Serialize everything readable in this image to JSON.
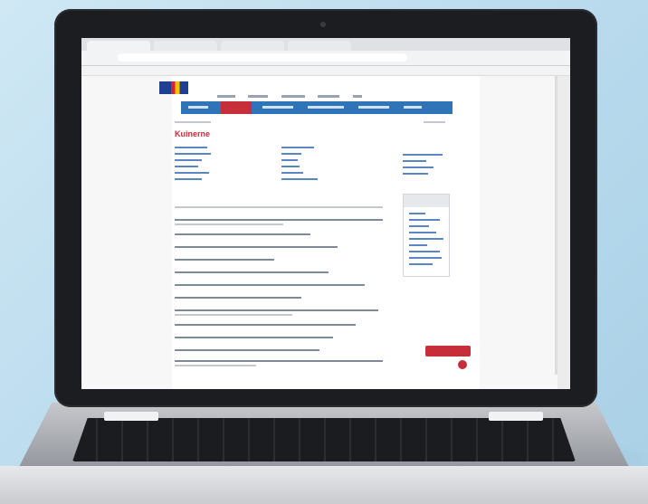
{
  "scene": {
    "background_color": "#bcdcee",
    "device": "laptop",
    "screen_content": "browser-webpage"
  },
  "webpage": {
    "heading": "Kuinerne",
    "accent_color": "#c62f3a",
    "nav_color": "#2f74b7"
  }
}
